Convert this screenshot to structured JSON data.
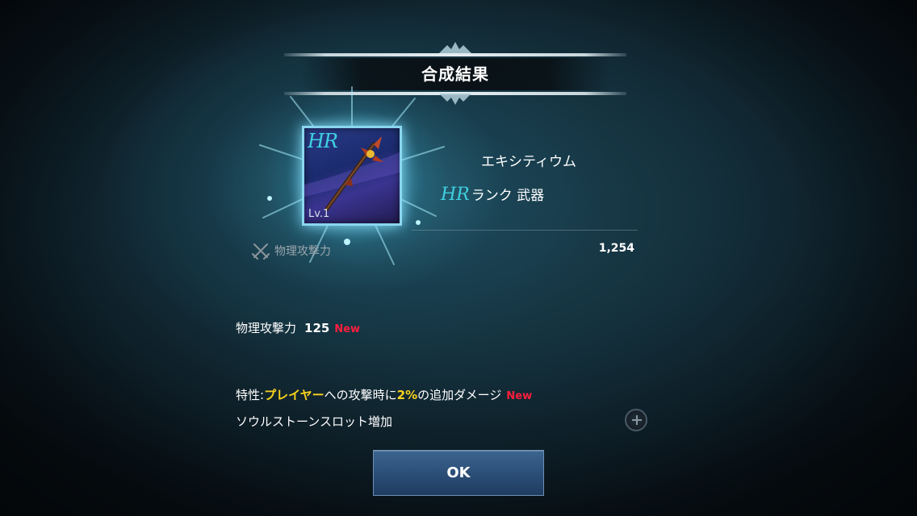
{
  "dialog": {
    "title": "合成結果"
  },
  "item": {
    "icon_rank": "HR",
    "icon_level": "Lv.1",
    "name": "エキシティウム",
    "rank_badge": "HR",
    "rank_text": "ランク 武器",
    "icon": "halberd-weapon-icon"
  },
  "stat": {
    "icon": "crossed-swords-icon",
    "label": "物理攻撃力",
    "value": "1,254"
  },
  "new_bonus": {
    "label": "物理攻撃力",
    "value": "125",
    "new_tag": "New"
  },
  "trait": {
    "prefix": "特性:",
    "target": "プレイヤー",
    "mid": "への攻撃時に",
    "percent": "2%",
    "suffix": "の追加ダメージ",
    "new_tag": "New"
  },
  "slot_text": "ソウルストーンスロット増加",
  "ok_label": "OK",
  "colors": {
    "accent_cyan": "#3fd0e0",
    "new_red": "#ff1e3c",
    "highlight_yellow": "#f6d21e",
    "button_blue": "#2a4d76"
  }
}
